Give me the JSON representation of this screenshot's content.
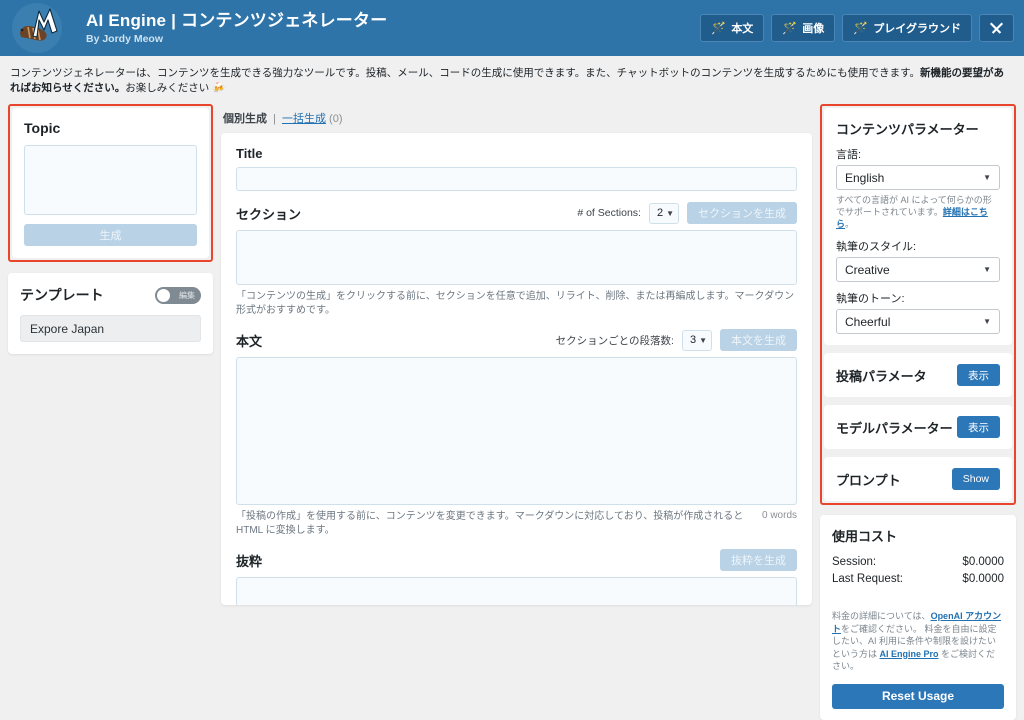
{
  "header": {
    "logo_icon": "meow-apps-caterpillar-logo",
    "title": "AI Engine | コンテンツジェネレーター",
    "subtitle": "By Jordy Meow",
    "buttons": [
      {
        "icon": "magic-wand-icon",
        "label": "本文"
      },
      {
        "icon": "magic-wand-icon",
        "label": "画像"
      },
      {
        "icon": "magic-wand-icon",
        "label": "プレイグラウンド"
      }
    ],
    "tools_button": {
      "icon": "tools-icon",
      "label": ""
    },
    "bg_color": "#2e74a8"
  },
  "intro": {
    "text_1": "コンテンツジェネレーターは、コンテンツを生成できる強力なツールです。投稿、メール、コードの生成に使用できます。また、チャットボットのコンテンツを生成するためにも使用できます。",
    "text_bold": "新機能の要望があればお知らせください。",
    "text_2": "お楽しみください 🍻"
  },
  "left": {
    "topic": {
      "title": "Topic",
      "value": "",
      "placeholder": "",
      "generate_label": "生成",
      "highlight_color": "#e8452c"
    },
    "template": {
      "title": "テンプレート",
      "toggle_label": "編集",
      "toggle_on": false,
      "selected": "Expore Japan"
    }
  },
  "main": {
    "tabs": {
      "current": "個別生成",
      "separator": "|",
      "bulk": "一括生成",
      "count": "(0)"
    },
    "title_field": {
      "label": "Title",
      "value": "",
      "placeholder": ""
    },
    "sections": {
      "label": "セクション",
      "count_label": "# of Sections:",
      "count_value": "2",
      "generate_button": "セクションを生成",
      "value": "",
      "hint": "「コンテンツの生成」をクリックする前に、セクションを任意で追加、リライト、削除、または再編成します。マークダウン形式がおすすめです。"
    },
    "body": {
      "label": "本文",
      "paragraphs_label": "セクションごとの段落数:",
      "paragraphs_value": "3",
      "generate_button": "本文を生成",
      "value": "",
      "hint": "「投稿の作成」を使用する前に、コンテンツを変更できます。マークダウンに対応しており、投稿が作成されると HTML に変換します。",
      "word_count": "0 words"
    },
    "excerpt": {
      "label": "抜粋",
      "generate_button": "抜粋を生成",
      "value": ""
    }
  },
  "right": {
    "content_params": {
      "title": "コンテンツパラメーター",
      "language_label": "言語:",
      "language_value": "English",
      "language_note_1": "すべての言語が AI によって何らかの形でサポートされています。",
      "language_note_link": "詳細はこちら",
      "language_note_2": "。",
      "style_label": "執筆のスタイル:",
      "style_value": "Creative",
      "tone_label": "執筆のトーン:",
      "tone_value": "Cheerful"
    },
    "post_params": {
      "title": "投稿パラメータ",
      "button": "表示"
    },
    "model_params": {
      "title": "モデルパラメーター",
      "button": "表示"
    },
    "prompt": {
      "title": "プロンプト",
      "button": "Show"
    },
    "usage": {
      "title": "使用コスト",
      "rows": [
        {
          "label": "Session:",
          "value": "$0.0000"
        },
        {
          "label": "Last Request:",
          "value": "$0.0000"
        }
      ],
      "note_1": "料金の詳細については、",
      "note_link_1": "OpenAI アカウント",
      "note_2": "をご確認ください。 料金を自由に設定したい、AI 利用に条件や制限を設けたいという方は ",
      "note_link_2": "AI Engine Pro",
      "note_3": " をご検討ください。",
      "reset_button": "Reset Usage"
    },
    "highlight_color": "#e8452c"
  }
}
